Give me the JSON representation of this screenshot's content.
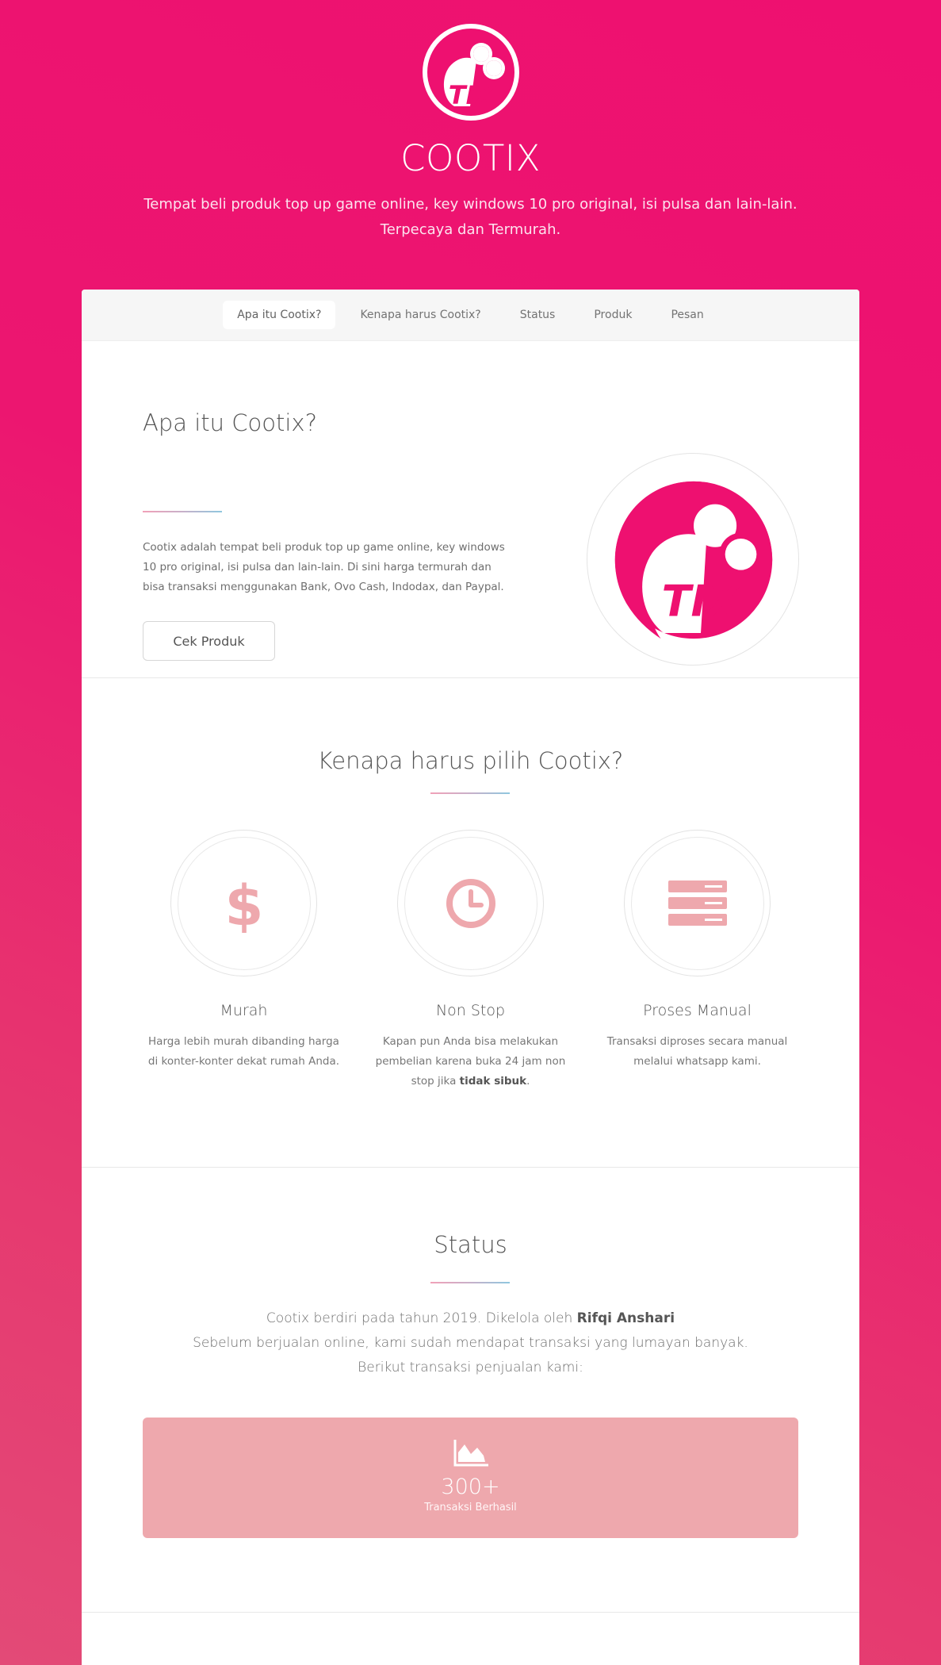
{
  "brand": {
    "logo_text": "TIX",
    "title": "COOTIX",
    "tagline_line1": "Tempat beli produk top up game online, key windows 10 pro original, isi pulsa dan lain-lain.",
    "tagline_line2": "Terpecaya dan Termurah.",
    "primary_color": "#ee1070"
  },
  "nav": {
    "items": [
      {
        "label": "Apa itu Cootix?",
        "active": true
      },
      {
        "label": "Kenapa harus Cootix?",
        "active": false
      },
      {
        "label": "Status",
        "active": false
      },
      {
        "label": "Produk",
        "active": false
      },
      {
        "label": "Pesan",
        "active": false
      }
    ]
  },
  "intro": {
    "title": "Apa itu Cootix?",
    "text": "Cootix adalah tempat beli produk top up game online, key windows 10 pro original, isi pulsa dan lain-lain. Di sini harga termurah dan bisa transaksi menggunakan Bank, Ovo Cash, Indodax, dan Paypal.",
    "button_label": "Cek Produk"
  },
  "why": {
    "title": "Kenapa harus pilih Cootix?",
    "features": [
      {
        "icon": "dollar-icon",
        "title": "Murah",
        "text": "Harga lebih murah dibanding harga di konter-konter dekat rumah Anda."
      },
      {
        "icon": "clock-icon",
        "title": "Non Stop",
        "text_before": "Kapan pun Anda bisa melakukan pembelian karena buka 24 jam non stop jika ",
        "text_bold": "tidak sibuk",
        "text_after": "."
      },
      {
        "icon": "server-icon",
        "title": "Proses Manual",
        "text": "Transaksi diproses secara manual melalui whatsapp kami."
      }
    ],
    "icon_color": "#eea8ad"
  },
  "status": {
    "title": "Status",
    "line1_before": "Cootix berdiri pada tahun 2019. Dikelola oleh ",
    "line1_bold": "Rifqi Anshari",
    "line2": "Sebelum berjualan online, kami sudah mendapat transaksi yang lumayan banyak.",
    "line3": "Berikut transaksi penjualan kami:",
    "stat": {
      "icon": "area-chart-icon",
      "value": "300+",
      "label": "Transaksi Berhasil"
    }
  }
}
